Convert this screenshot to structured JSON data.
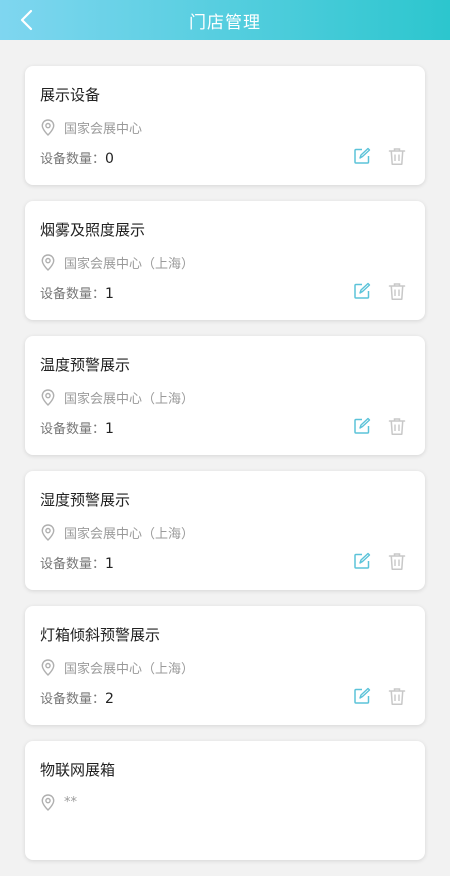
{
  "header": {
    "title": "门店管理"
  },
  "stores": [
    {
      "name": "展示设备",
      "location": "国家会展中心",
      "count_label": "设备数量：",
      "count": "0"
    },
    {
      "name": "烟雾及照度展示",
      "location": "国家会展中心（上海）",
      "count_label": "设备数量：",
      "count": "1"
    },
    {
      "name": "温度预警展示",
      "location": "国家会展中心（上海）",
      "count_label": "设备数量：",
      "count": "1"
    },
    {
      "name": "湿度预警展示",
      "location": "国家会展中心（上海）",
      "count_label": "设备数量：",
      "count": "1"
    },
    {
      "name": "灯箱倾斜预警展示",
      "location": "国家会展中心（上海）",
      "count_label": "设备数量：",
      "count": "2"
    },
    {
      "name": "物联网展箱",
      "location": "**",
      "count_label": "",
      "count": ""
    }
  ],
  "colors": {
    "header_start": "#7fd6f0",
    "header_end": "#2cc6ce",
    "accent": "#5bc3d9",
    "icon_gray": "#c8c8c8"
  },
  "icons": {
    "back": "chevron-left-icon",
    "location": "map-pin-icon",
    "edit": "edit-icon",
    "delete": "trash-icon"
  }
}
